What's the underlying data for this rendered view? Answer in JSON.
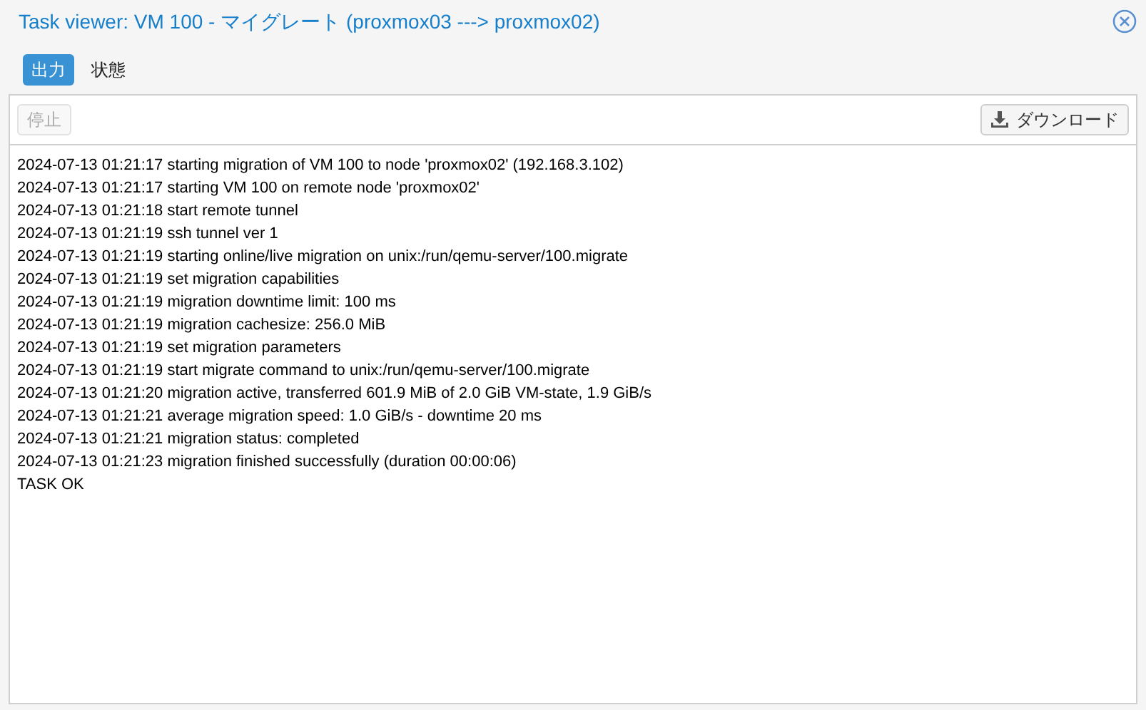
{
  "window": {
    "title": "Task viewer: VM 100 - マイグレート (proxmox03 ---> proxmox02)"
  },
  "tabs": [
    {
      "label": "出力",
      "selected": true
    },
    {
      "label": "状態",
      "selected": false
    }
  ],
  "toolbar": {
    "stop_button": {
      "label": "停止",
      "disabled": true
    },
    "download_button": {
      "label": "ダウンロード"
    }
  },
  "log_lines": [
    "2024-07-13 01:21:17 starting migration of VM 100 to node 'proxmox02' (192.168.3.102)",
    "2024-07-13 01:21:17 starting VM 100 on remote node 'proxmox02'",
    "2024-07-13 01:21:18 start remote tunnel",
    "2024-07-13 01:21:19 ssh tunnel ver 1",
    "2024-07-13 01:21:19 starting online/live migration on unix:/run/qemu-server/100.migrate",
    "2024-07-13 01:21:19 set migration capabilities",
    "2024-07-13 01:21:19 migration downtime limit: 100 ms",
    "2024-07-13 01:21:19 migration cachesize: 256.0 MiB",
    "2024-07-13 01:21:19 set migration parameters",
    "2024-07-13 01:21:19 start migrate command to unix:/run/qemu-server/100.migrate",
    "2024-07-13 01:21:20 migration active, transferred 601.9 MiB of 2.0 GiB VM-state, 1.9 GiB/s",
    "2024-07-13 01:21:21 average migration speed: 1.0 GiB/s - downtime 20 ms",
    "2024-07-13 01:21:21 migration status: completed",
    "2024-07-13 01:21:23 migration finished successfully (duration 00:00:06)",
    "TASK OK"
  ]
}
